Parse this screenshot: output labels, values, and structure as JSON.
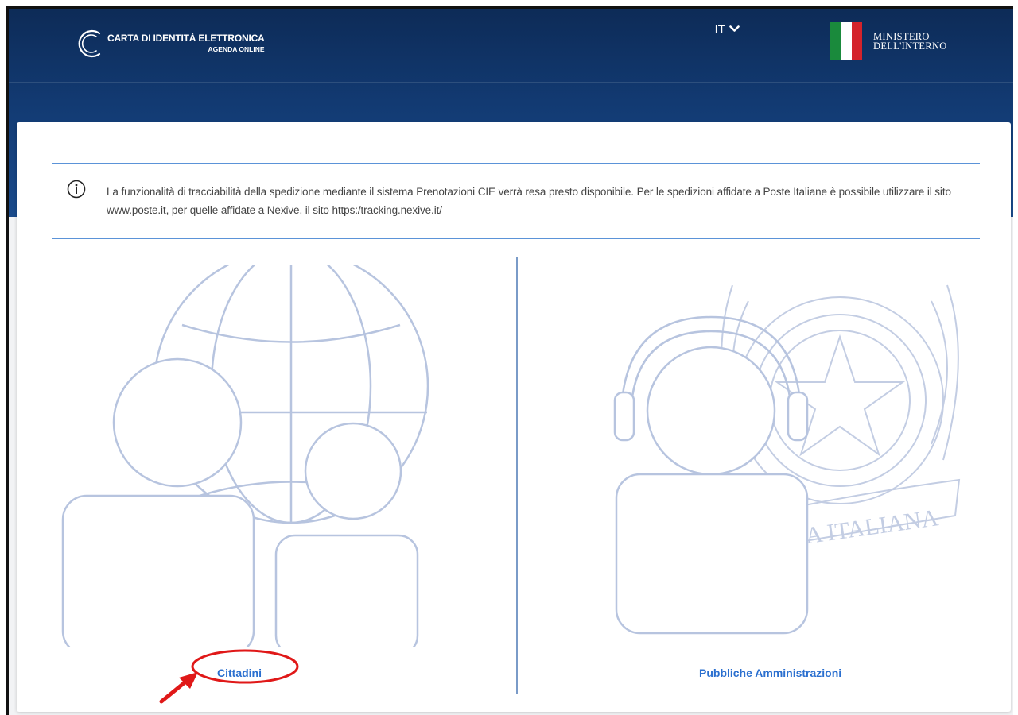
{
  "header": {
    "app_title": "CARTA DI IDENTITÀ ELETTRONICA",
    "app_subtitle": "AGENDA ONLINE",
    "language": "IT",
    "ministry_line1": "MINISTERO",
    "ministry_line2": "DELL'INTERNO"
  },
  "notice": {
    "icon": "info-icon",
    "text": "La funzionalità di tracciabilità della spedizione mediante il sistema Prenotazioni CIE verrà resa presto disponibile. Per le spedizioni affidate a Poste Italiane è possibile utilizzare il sito www.poste.it, per quelle affidate a Nexive, il sito https:/tracking.nexive.it/"
  },
  "panels": {
    "citizens_label": "Cittadini",
    "public_admin_label": "Pubbliche Amministrazioni",
    "emblem_text": "CA ITALIANA"
  },
  "colors": {
    "header_bg": "#123a72",
    "accent": "#2a6fcf",
    "illustration_stroke": "#b7c4df",
    "annotation_red": "#e01818"
  }
}
